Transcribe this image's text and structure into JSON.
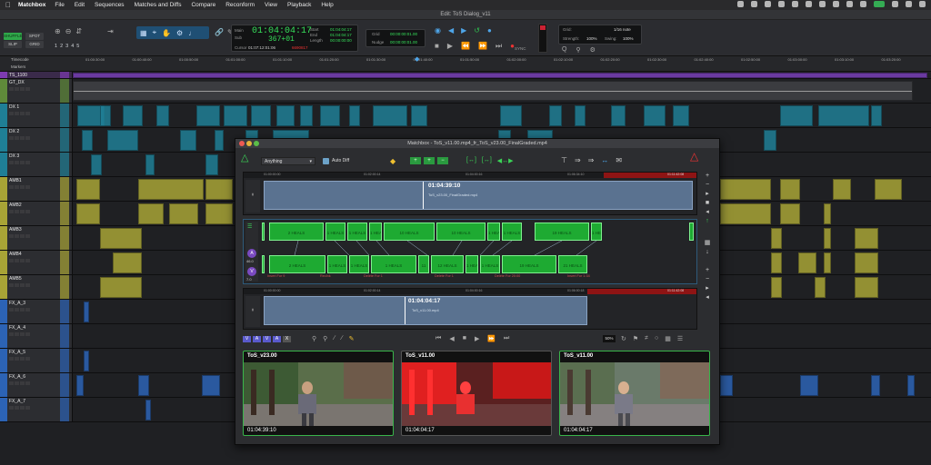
{
  "menubar": {
    "app_name": "Matchbox",
    "items": [
      "File",
      "Edit",
      "Sequences",
      "Matches and Diffs",
      "Compare",
      "Reconform",
      "View",
      "Playback",
      "Help"
    ]
  },
  "window_title": "Edit: ToS Dialog_v11",
  "toolbar": {
    "modes": [
      "SHUFFLE",
      "SPOT",
      "SLIP",
      "GRID"
    ],
    "numbers": [
      "1",
      "2",
      "3",
      "4",
      "5"
    ],
    "main_label": "Main",
    "sub_label": "Sub",
    "main_counter": "01:04:04:17",
    "sub_counter": "367+01",
    "cursor_label": "Cursor",
    "cursor_value": "01:07:12:01:06",
    "start_label": "Start",
    "end_label": "End",
    "length_label": "Length",
    "start_value": "01:04:04:17",
    "end_value": "01:04:04:17",
    "length_value": "00:00:00:00",
    "cursor_extra": "6690817",
    "grid_label": "Grid",
    "nudge_label": "Nudge",
    "grid_value": "00:00:00:01.00",
    "nudge_value": "00:00:00:01.00",
    "sync_label": "SYNC",
    "grid2_label": "Grid:",
    "grid2_value": "1/16 note",
    "strength_label": "Strength:",
    "strength_value": "100%",
    "swing_label": "Swing:",
    "swing_value": "100%"
  },
  "ruler": {
    "timecode_label": "Timecode",
    "markers_label": "Markers",
    "ticks": [
      "01:00:30:00",
      "01:00:40:00",
      "01:00:50:00",
      "01:01:00:00",
      "01:01:10:00",
      "01:01:20:00",
      "01:01:30:00",
      "01:01:40:00",
      "01:01:50:00",
      "01:02:00:00",
      "01:02:10:00",
      "01:02:20:00",
      "01:02:30:00",
      "01:02:40:00",
      "01:02:50:00",
      "01:03:00:00",
      "01:03:10:00",
      "01:03:20:00"
    ]
  },
  "tracks": [
    {
      "name": "TS_1100",
      "color": "#7d3bb0"
    },
    {
      "name": "GT_DX",
      "color": "#5f8a3a"
    },
    {
      "name": "DX 1",
      "color": "#1f7f96"
    },
    {
      "name": "DX 2",
      "color": "#1f7f96"
    },
    {
      "name": "DX 3",
      "color": "#1f7f96"
    },
    {
      "name": "AMB1",
      "color": "#a8a436"
    },
    {
      "name": "AMB2",
      "color": "#a8a436"
    },
    {
      "name": "AMB3",
      "color": "#a8a436"
    },
    {
      "name": "AMB4",
      "color": "#a8a436"
    },
    {
      "name": "AMB5",
      "color": "#a8a436"
    },
    {
      "name": "FX_A_3",
      "color": "#2c63b5"
    },
    {
      "name": "FX_A_4",
      "color": "#2c63b5"
    },
    {
      "name": "FX_A_5",
      "color": "#2c63b5"
    },
    {
      "name": "FX_A_6",
      "color": "#2c63b5"
    },
    {
      "name": "FX_A_7",
      "color": "#2c63b5"
    }
  ],
  "dialog": {
    "title": "Matchbox - ToS_v11.00.mp4_fr_ToS_v23.00_FinalGraded.mp4",
    "filter_value": "Anything",
    "auto_diff_label": "Auto Diff",
    "top_timecode": "01:04:39:10",
    "top_clip_name": "ToS_v23.00_FinalGraded.mp4",
    "bottom_timecode": "01:04:04:17",
    "bottom_clip_name": "ToS_v11.00.mp4",
    "top_ruler": [
      "01:00:00:00",
      "01:02:00:14",
      "01:04:00:16",
      "01:06:34:10",
      "01:11:42:08"
    ],
    "bottom_ruler": [
      "01:00:00:00",
      "01:02:00:14",
      "01:04:00:16",
      "01:06:00:18",
      "01:11:42:08"
    ],
    "side_value": "46.0",
    "side_value2": "7.0",
    "upper_segments": [
      "2 HEALS",
      "1 HEALS",
      "1 HEALS",
      "1 HEALS",
      "10 HEALS",
      "10 HEALS",
      "1 HEALS",
      "1 HEALS",
      "19 HEALS",
      "1 HEALS"
    ],
    "lower_segments": [
      "2 HEALS",
      "1 HEALS",
      "1 HEALS",
      "1 HEALS",
      "11",
      "12 HEALS",
      "1 HEALS",
      "1 HEALS",
      "19 HEALS",
      "21 HEALS"
    ],
    "edits": [
      "Insert For 9",
      "Reclnk",
      "Delete For 1",
      "Delete For 1",
      "Delete For 20:00",
      "Insert For 1:34"
    ],
    "zoom_value": "50%",
    "thumbs": [
      {
        "title": "ToS_v23.00",
        "tc": "01:04:39:10"
      },
      {
        "title": "ToS_v11.00",
        "tc": "01:04:04:17"
      },
      {
        "title": "ToS_v11.00",
        "tc": "01:04:04:17"
      }
    ]
  }
}
